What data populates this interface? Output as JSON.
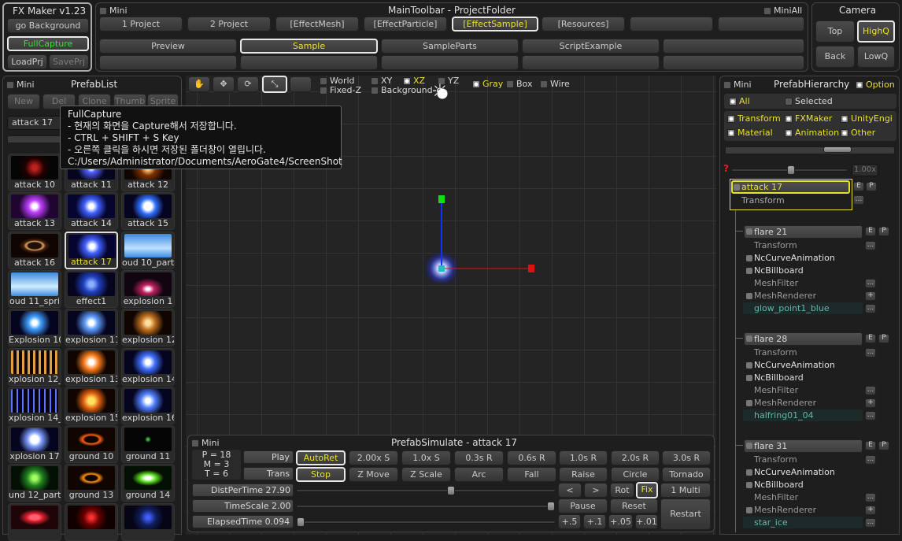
{
  "fxmaker": {
    "title": "FX Maker v1.23",
    "go_background": "go Background",
    "full_capture": "FullCapture",
    "load_prj": "LoadPrj",
    "save_prj": "SavePrj"
  },
  "main_toolbar": {
    "mini": "Mini",
    "title": "MainToolbar - ProjectFolder",
    "mini_all": "MiniAll",
    "row1": [
      "1 Project",
      "2 Project",
      "[EffectMesh]",
      "[EffectParticle]",
      "[EffectSample]",
      "[Resources]",
      "",
      ""
    ],
    "row2": [
      "Preview",
      "Sample",
      "SampleParts",
      "ScriptExample",
      ""
    ]
  },
  "camera": {
    "title": "Camera",
    "top": "Top",
    "highq": "HighQ",
    "back": "Back",
    "lowq": "LowQ"
  },
  "prefab_list": {
    "mini": "Mini",
    "title": "PrefabList",
    "buttons": [
      "New",
      "Del",
      "Clone",
      "Thumb",
      "Sprite"
    ],
    "search": "attack 17",
    "items": [
      "attack 10",
      "attack 11",
      "attack 12",
      "attack 13",
      "attack 14",
      "attack 15",
      "attack 16",
      "attack 17",
      "oud 10_partic",
      "oud 11_spri",
      "effect1",
      "explosion 1",
      "Explosion 10",
      "explosion 11",
      "explosion 12",
      "xplosion 12_",
      "explosion 13",
      "explosion 14",
      "xplosion 14_",
      "explosion 15",
      "explosion 16",
      "xplosion 17",
      "ground 10",
      "ground 11",
      "und 12_part",
      "ground 13",
      "ground 14",
      "",
      "",
      ""
    ]
  },
  "tooltip": {
    "lines": [
      "FullCapture",
      "- 현재의 화면을 Capture해서 저장합니다.",
      "- CTRL + SHIFT + S Key",
      "- 오른쪽 클릭을 하시면 저장된 폴더창이 열립니다.",
      "C:/Users/Administrator/Documents/AeroGate4/ScreenShot"
    ]
  },
  "scene_toolbar": {
    "world": "World",
    "fixed_z": "Fixed-Z",
    "xy": "XY",
    "xz": "XZ",
    "yz": "YZ",
    "background": "Background",
    "gray": "Gray",
    "box": "Box",
    "wire": "Wire"
  },
  "hierarchy": {
    "mini": "Mini",
    "title": "PrefabHierarchy",
    "option": "Option",
    "all": "All",
    "selected": "Selected",
    "filters": [
      "Transform",
      "FXMaker",
      "UnityEngi",
      "Material",
      "Animation",
      "Other"
    ],
    "scale": "1.00x",
    "root": {
      "name": "attack 17",
      "transform": "Transform"
    },
    "groups": [
      {
        "name": "flare 21",
        "rows": [
          "Transform",
          "NcCurveAnimation",
          "NcBillboard",
          "MeshFilter",
          "MeshRenderer",
          "glow_point1_blue"
        ]
      },
      {
        "name": "flare 28",
        "rows": [
          "Transform",
          "NcCurveAnimation",
          "NcBillboard",
          "MeshFilter",
          "MeshRenderer",
          "halfring01_04"
        ]
      },
      {
        "name": "flare 31",
        "rows": [
          "Transform",
          "NcCurveAnimation",
          "NcBillboard",
          "MeshFilter",
          "MeshRenderer",
          "star_ice"
        ]
      }
    ],
    "e": "E",
    "p": "P",
    "dots": "...",
    "plus": "+"
  },
  "simulate": {
    "mini": "Mini",
    "title": "PrefabSimulate - attack 17",
    "pmt": [
      "P = 18",
      "M = 3",
      "T = 6"
    ],
    "play": "Play",
    "trans": "Trans",
    "play_row": [
      "AutoRet",
      "2.00x S",
      "1.0x S",
      "0.3s R",
      "0.6s R",
      "1.0s R",
      "2.0s R",
      "3.0s R"
    ],
    "trans_row": [
      "Stop",
      "Z Move",
      "Z Scale",
      "Arc",
      "Fall",
      "Raise",
      "Circle",
      "Tornado"
    ],
    "dist": "DistPerTime 27.90",
    "timescale": "TimeScale 2.00",
    "elapsed": "ElapsedTime 0.094",
    "dist_btns": [
      "<",
      ">",
      "Rot",
      "Fix",
      "1 Multi"
    ],
    "ts_btns": [
      "Pause",
      "Reset"
    ],
    "el_btns": [
      "+.5",
      "+.1",
      "+.05",
      "+.01"
    ],
    "restart": "Restart",
    "dist_level": 0.6,
    "timescale_level": 1.0,
    "elapsed_level": 0.0
  },
  "colors": {
    "accent": "#e8e030",
    "green": "#38e038",
    "axis_x": "#e01010",
    "axis_y": "#10e010",
    "axis_z": "#1030ff"
  }
}
